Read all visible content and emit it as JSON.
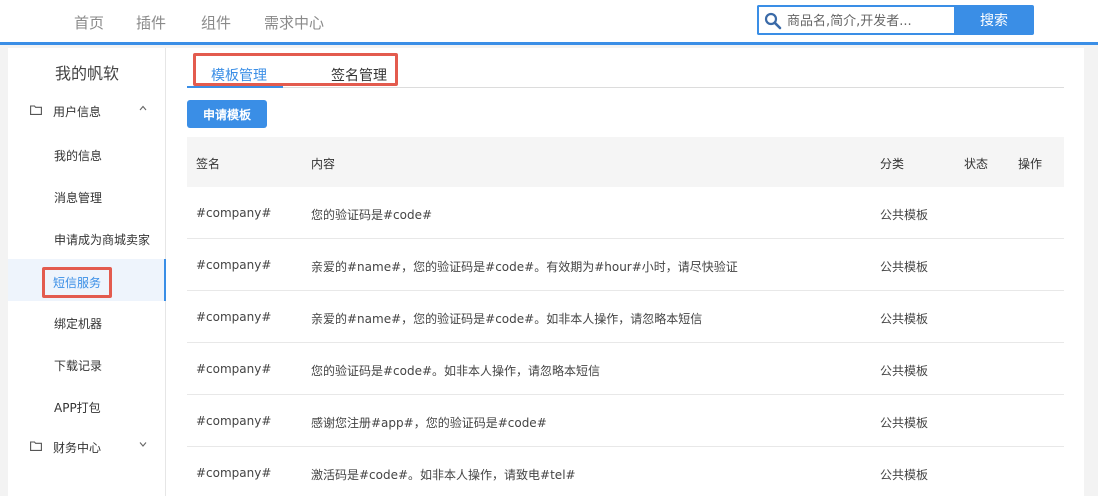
{
  "topnav": {
    "items": [
      "首页",
      "插件",
      "组件",
      "需求中心"
    ],
    "search_placeholder": "商品名,简介,开发者...",
    "search_button": "搜索"
  },
  "sidebar": {
    "title": "我的帆软",
    "group1": "用户信息",
    "items": [
      "我的信息",
      "消息管理",
      "申请成为商城卖家",
      "短信服务",
      "绑定机器",
      "下载记录",
      "APP打包"
    ],
    "active_item": "短信服务",
    "group2": "财务中心"
  },
  "tabs": [
    "模板管理",
    "签名管理"
  ],
  "apply_button": "申请模板",
  "table": {
    "columns": [
      "签名",
      "内容",
      "分类",
      "状态",
      "操作"
    ],
    "rows": [
      {
        "sign": "#company#",
        "content": "您的验证码是#code#",
        "category": "公共模板",
        "status": "",
        "action": ""
      },
      {
        "sign": "#company#",
        "content": "亲爱的#name#，您的验证码是#code#。有效期为#hour#小时，请尽快验证",
        "category": "公共模板",
        "status": "",
        "action": ""
      },
      {
        "sign": "#company#",
        "content": "亲爱的#name#，您的验证码是#code#。如非本人操作，请忽略本短信",
        "category": "公共模板",
        "status": "",
        "action": ""
      },
      {
        "sign": "#company#",
        "content": "您的验证码是#code#。如非本人操作，请忽略本短信",
        "category": "公共模板",
        "status": "",
        "action": ""
      },
      {
        "sign": "#company#",
        "content": "感谢您注册#app#，您的验证码是#code#",
        "category": "公共模板",
        "status": "",
        "action": ""
      },
      {
        "sign": "#company#",
        "content": "激活码是#code#。如非本人操作，请致电#tel#",
        "category": "公共模板",
        "status": "",
        "action": ""
      }
    ]
  },
  "colors": {
    "accent": "#3a8ee6",
    "highlight_border": "#e35b4e",
    "page_bg": "#f3f3f3",
    "header_bg": "#f5f5f5"
  },
  "icons": [
    "search-icon",
    "folder-icon",
    "chevron-up-icon",
    "chevron-down-icon"
  ]
}
